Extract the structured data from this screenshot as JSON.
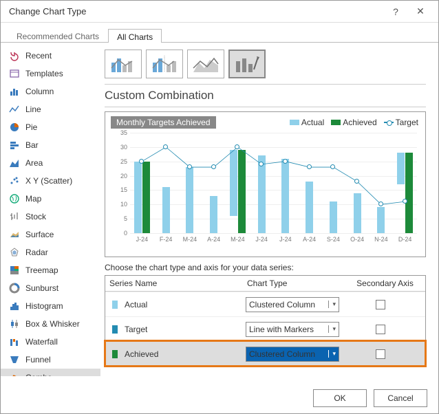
{
  "window": {
    "title": "Change Chart Type"
  },
  "tabs": {
    "recommended": "Recommended Charts",
    "all": "All Charts",
    "active": "all"
  },
  "sidebar": {
    "items": [
      "Recent",
      "Templates",
      "Column",
      "Line",
      "Pie",
      "Bar",
      "Area",
      "X Y (Scatter)",
      "Map",
      "Stock",
      "Surface",
      "Radar",
      "Treemap",
      "Sunburst",
      "Histogram",
      "Box & Whisker",
      "Waterfall",
      "Funnel",
      "Combo"
    ],
    "selected": "Combo"
  },
  "section_title": "Custom Combination",
  "chart_data": {
    "type": "combo",
    "title": "Monthly Targets Achieved",
    "categories": [
      "J-24",
      "F-24",
      "M-24",
      "A-24",
      "M-24",
      "J-24",
      "J-24",
      "A-24",
      "S-24",
      "O-24",
      "N-24",
      "D-24"
    ],
    "series": [
      {
        "name": "Actual",
        "type": "bar",
        "color": "#8fd0ea",
        "values": [
          25,
          16,
          23,
          13,
          23,
          27,
          26,
          18,
          11,
          14,
          9,
          11
        ]
      },
      {
        "name": "Achieved",
        "type": "bar",
        "color": "#1d8a3a",
        "values": [
          25,
          null,
          null,
          null,
          29,
          null,
          null,
          null,
          null,
          null,
          null,
          28
        ]
      },
      {
        "name": "Target",
        "type": "line",
        "color": "#238bb1",
        "values": [
          25,
          30,
          23,
          23,
          30,
          24,
          25,
          23,
          23,
          18,
          10,
          11
        ]
      }
    ],
    "ylim": [
      0,
      35
    ],
    "ytick": 5,
    "legend_position": "top-right",
    "xlabel": "",
    "ylabel": ""
  },
  "instruction": "Choose the chart type and axis for your data series:",
  "table": {
    "headers": {
      "name": "Series Name",
      "type": "Chart Type",
      "axis": "Secondary Axis"
    },
    "rows": [
      {
        "swatch": "#8fd0ea",
        "name": "Actual",
        "type": "Clustered Column",
        "secondary": false,
        "highlight": false
      },
      {
        "swatch": "#238bb1",
        "name": "Target",
        "type": "Line with Markers",
        "secondary": false,
        "highlight": false
      },
      {
        "swatch": "#1d8a3a",
        "name": "Achieved",
        "type": "Clustered Column",
        "secondary": false,
        "highlight": true
      }
    ]
  },
  "buttons": {
    "ok": "OK",
    "cancel": "Cancel"
  }
}
